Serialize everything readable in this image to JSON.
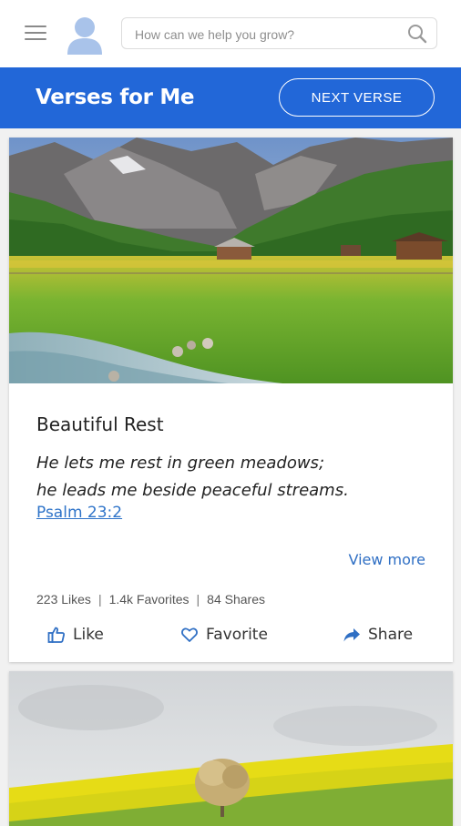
{
  "header": {
    "menu_icon": "hamburger-menu-icon",
    "avatar_icon": "user-avatar-icon",
    "search": {
      "placeholder": "How can we help you grow?",
      "icon": "search-icon"
    }
  },
  "banner": {
    "title": "Verses for Me",
    "next_label": "NEXT VERSE",
    "color": "#2267d8"
  },
  "verse_card": {
    "image": "mountain-meadow-stream",
    "title": "Beautiful Rest",
    "text_lines": [
      "He lets me rest in green meadows;",
      "he leads me beside peaceful streams."
    ],
    "reference": "Psalm 23:2",
    "view_more": "View more",
    "stats": {
      "likes": "223 Likes",
      "favorites": "1.4k Favorites",
      "shares": "84 Shares",
      "separator": "|"
    },
    "actions": {
      "like": {
        "label": "Like",
        "icon": "thumbs-up-icon"
      },
      "favorite": {
        "label": "Favorite",
        "icon": "heart-icon"
      },
      "share": {
        "label": "Share",
        "icon": "share-arrow-icon"
      }
    }
  },
  "next_card": {
    "image": "yellow-field-tree"
  },
  "colors": {
    "accent": "#2267d8",
    "link": "#2f74c9"
  }
}
